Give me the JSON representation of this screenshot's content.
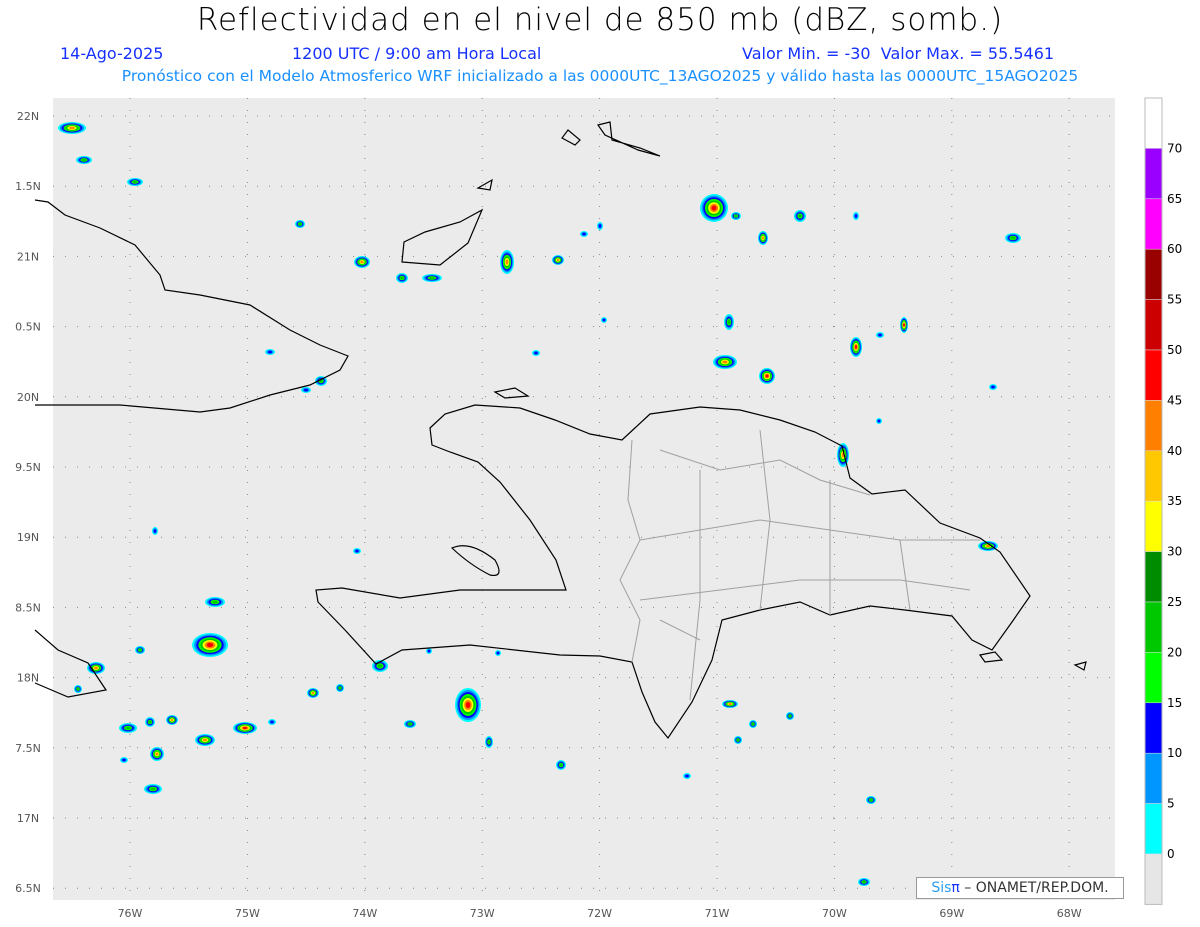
{
  "title": "Reflectividad en el nivel de 850 mb (dBZ, somb.)",
  "date": "14-Ago-2025",
  "time": "1200 UTC / 9:00 am Hora Local",
  "range": "Valor Min. = -30  Valor Max. = 55.5461",
  "info": "Pronóstico con el Modelo Atmosferico WRF inicializado a las 0000UTC_13AGO2025 y válido hasta las  0000UTC_15AGO2025",
  "lon_labels": [
    "76W",
    "75W",
    "74W",
    "73W",
    "72W",
    "71W",
    "70W",
    "69W",
    "68W"
  ],
  "lat_labels": [
    "22N",
    "1.5N",
    "21N",
    "0.5N",
    "20N",
    "9.5N",
    "19N",
    "8.5N",
    "18N",
    "7.5N",
    "17N",
    "6.5N"
  ],
  "colorbar": {
    "labels": [
      "70",
      "65",
      "60",
      "55",
      "50",
      "45",
      "40",
      "35",
      "30",
      "25",
      "20",
      "15",
      "10",
      "5",
      "0"
    ],
    "colors": [
      "#ffffff",
      "#9900ff",
      "#ff00ff",
      "#990000",
      "#cc0000",
      "#ff0000",
      "#ff7f00",
      "#ffc800",
      "#ffff00",
      "#008c00",
      "#00c800",
      "#00ff00",
      "#0000ff",
      "#0096ff",
      "#00ffff",
      "#e6e6e6"
    ]
  },
  "credit": {
    "brand_a": "Sis",
    "brand_b": "π",
    "org": " – ONAMET/REP.DOM."
  }
}
